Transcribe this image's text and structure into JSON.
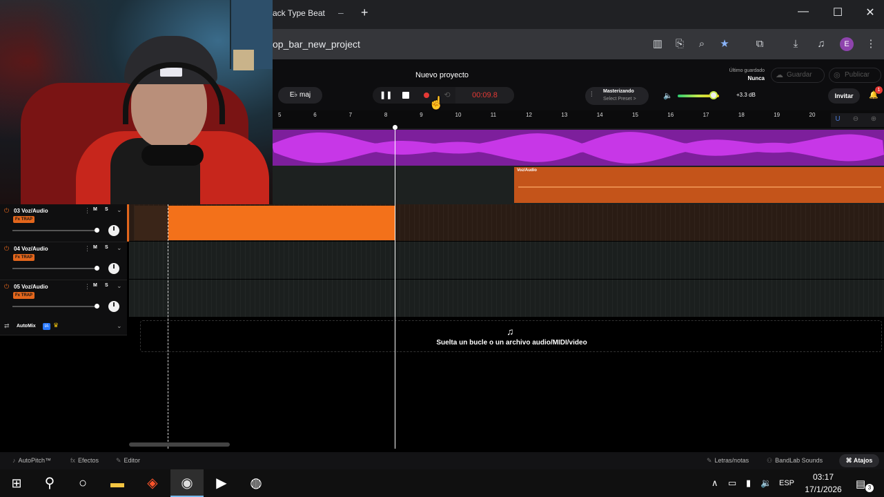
{
  "browser": {
    "tab_title": "ack Type Beat",
    "tab_close": "–",
    "new_tab": "+",
    "url": "op_bar_new_project",
    "avatar_letter": "E",
    "window_controls": {
      "minimize": "—",
      "maximize": "☐",
      "close": "✕"
    }
  },
  "daw": {
    "project_title": "Nuevo proyecto",
    "last_saved_label": "Último guardado",
    "last_saved_value": "Nunca",
    "save_label": "Guardar",
    "publish_label": "Publicar",
    "mode_label": "E♭ maj",
    "time_display": "00:09.8",
    "master_title": "Masterizando",
    "master_preset": "Select Preset >",
    "volume_db": "+3.3 dB",
    "volume_level": 0.85,
    "invite_label": "Invitar",
    "notification_count": "1",
    "ruler_ticks": [
      "5",
      "6",
      "7",
      "8",
      "9",
      "10",
      "11",
      "12",
      "13",
      "14",
      "15",
      "16",
      "17",
      "18",
      "19",
      "20"
    ],
    "tracks": [
      {
        "name": "03 Voz/Audio",
        "fx": "Fx TRAP",
        "mute": "M",
        "solo": "S"
      },
      {
        "name": "04 Voz/Audio",
        "fx": "Fx TRAP",
        "mute": "M",
        "solo": "S"
      },
      {
        "name": "05 Voz/Audio",
        "fx": "Fx TRAP",
        "mute": "M",
        "solo": "S"
      }
    ],
    "upper_clip_label": "Voz/Audio",
    "automix_label": "AutoMix",
    "automix_badge": "IA",
    "drop_text": "Suelta un bucle o un archivo audio/MIDI/video",
    "footer": {
      "autopitch": "AutoPitch™",
      "effects": "Efectos",
      "editor": "Editor",
      "lyrics": "Letras/notas",
      "sounds": "BandLab Sounds",
      "shortcuts": "Atajos"
    },
    "colors": {
      "accent_orange": "#f3711a",
      "clip_purple": "#7d1f9c",
      "record_red": "#e53935"
    }
  },
  "taskbar": {
    "language": "ESP",
    "time": "03:17",
    "date": "17/1/2026",
    "notification_count": "3"
  }
}
